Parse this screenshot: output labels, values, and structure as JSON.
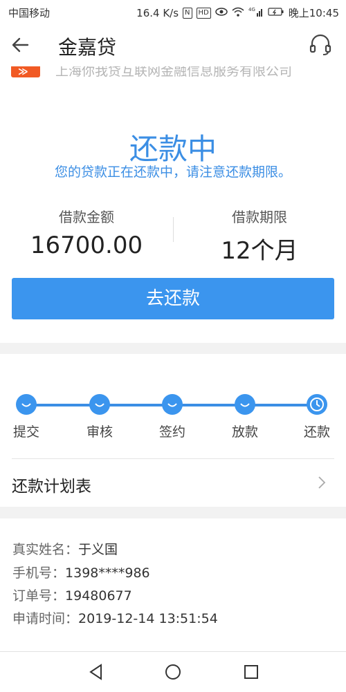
{
  "status_bar": {
    "carrier": "中国移动",
    "speed": "16.4 K/s",
    "nfc_icon": "N",
    "hd_label": "HD",
    "network": "4G",
    "time": "晚上10:45"
  },
  "app_bar": {
    "title": "金嘉贷"
  },
  "company": {
    "name": "上海你我贷互联网金融信息服务有限公司"
  },
  "loan_status": {
    "title": "还款中",
    "subtitle": "您的贷款正在还款中，请注意还款期限。"
  },
  "loan_summary": {
    "amount_label": "借款金额",
    "amount_value": "16700.00",
    "term_label": "借款期限",
    "term_value": "12个月"
  },
  "actions": {
    "repay_label": "去还款"
  },
  "progress": {
    "steps": [
      {
        "label": "提交",
        "icon": "smile-icon"
      },
      {
        "label": "审核",
        "icon": "smile-icon"
      },
      {
        "label": "签约",
        "icon": "smile-icon"
      },
      {
        "label": "放款",
        "icon": "smile-icon"
      },
      {
        "label": "还款",
        "icon": "clock-icon"
      }
    ],
    "plan_label": "还款计划表"
  },
  "applicant": {
    "name_label": "真实姓名：",
    "name_value": "于义国",
    "phone_label": "手机号：",
    "phone_value": "1398****986",
    "order_label": "订单号：",
    "order_value": "19480677",
    "time_label": "申请时间：",
    "time_value": "2019-12-14 13:51:54"
  },
  "colors": {
    "accent": "#3b95ee",
    "accent_text": "#3b8ee4",
    "logo": "#f15a24"
  }
}
